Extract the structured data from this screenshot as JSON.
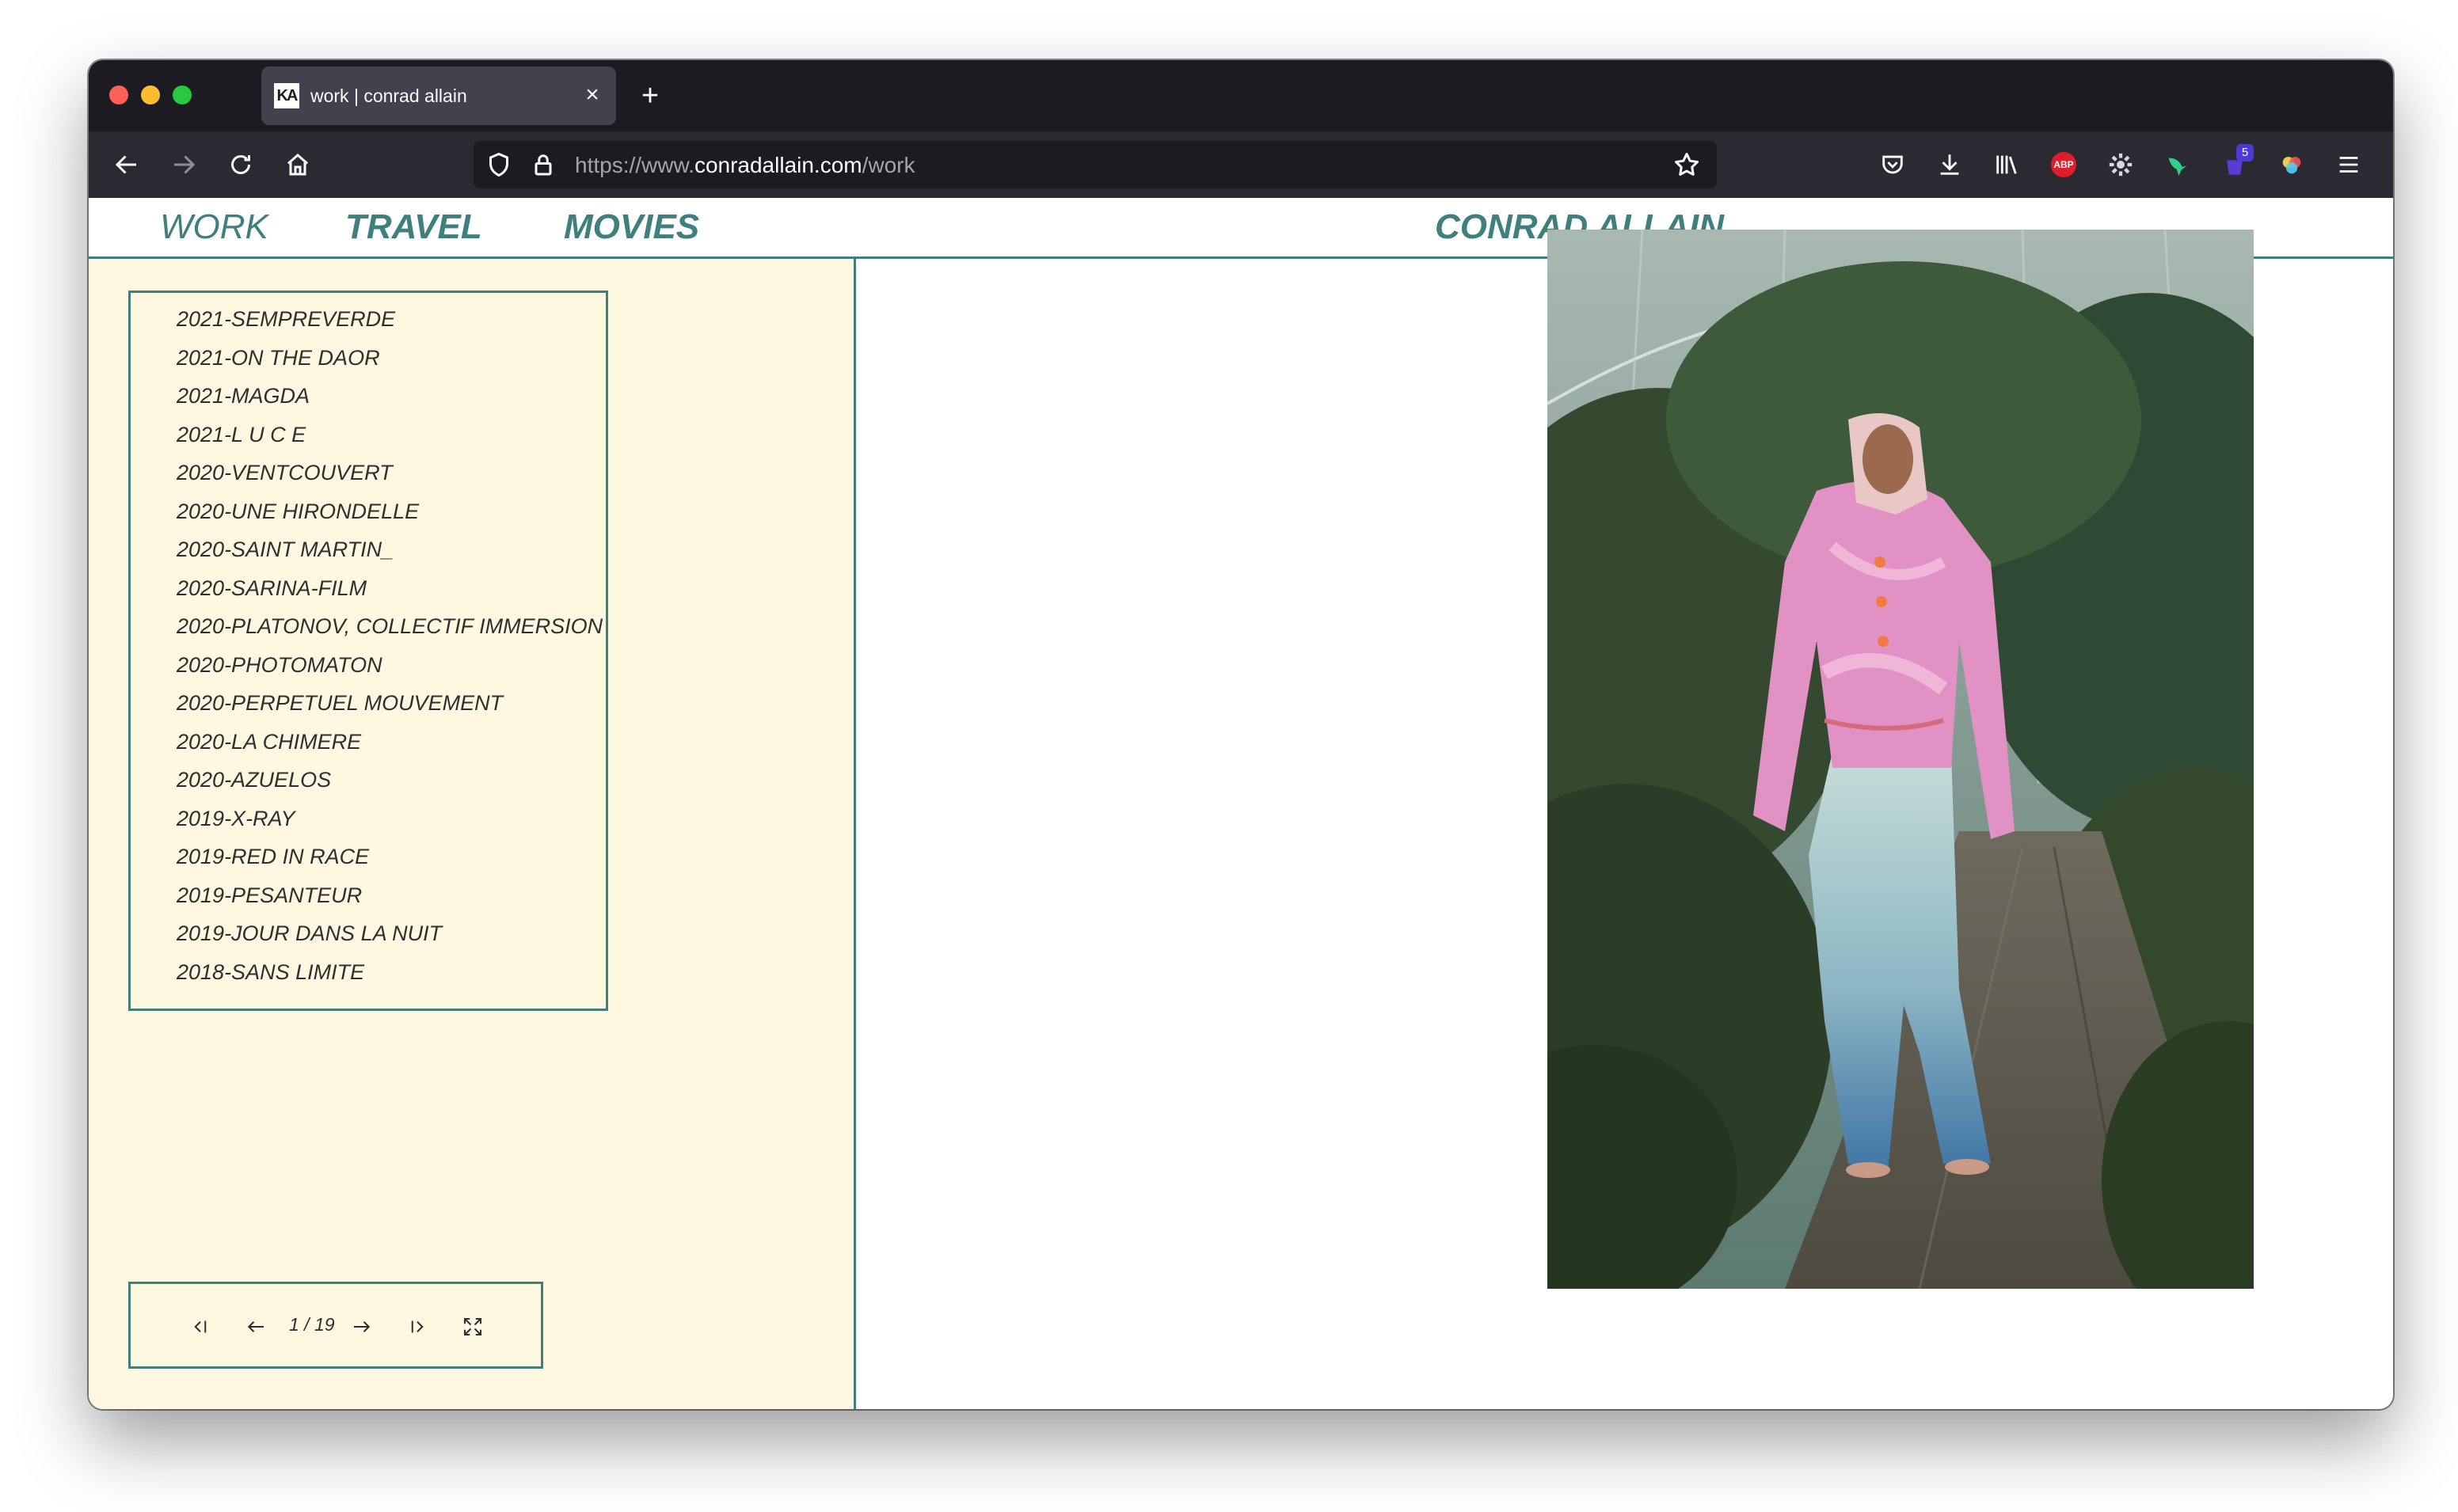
{
  "browser": {
    "tab": {
      "favicon_text": "KA",
      "title": "work | conrad allain",
      "close_glyph": "×"
    },
    "new_tab_glyph": "+",
    "url": {
      "scheme": "https://www.",
      "host": "conradallain.com",
      "path": "/work"
    },
    "extensions": {
      "abp_label": "ABP",
      "badge_count": "5"
    }
  },
  "site": {
    "nav": {
      "work": "WORK",
      "travel": "TRAVEL",
      "movies": "MOVIES"
    },
    "title": "CONRAD ALLAIN",
    "accent_color": "#3f807f",
    "sidebar_color": "#fdf8df"
  },
  "works": [
    "2021-SEMPREVERDE",
    "2021-ON THE DAOR",
    "2021-MAGDA",
    "2021-L U C E",
    "2020-VENTCOUVERT",
    "2020-UNE HIRONDELLE",
    "2020-SAINT MARTIN_",
    "2020-SARINA-FILM",
    "2020-PLATONOV, COLLECTIF IMMERSION",
    "2020-PHOTOMATON",
    "2020-PERPETUEL MOUVEMENT",
    "2020-LA CHIMERE",
    "2020-AZUELOS",
    "2019-X-RAY",
    "2019-RED IN RACE",
    "2019-PESANTEUR",
    "2019-JOUR DANS LA NUIT",
    "2018-SANS LIMITE"
  ],
  "pager": {
    "count": "1 / 19",
    "icons": [
      "first-icon",
      "prev-icon",
      "next-icon",
      "last-icon",
      "fullscreen-icon"
    ]
  }
}
